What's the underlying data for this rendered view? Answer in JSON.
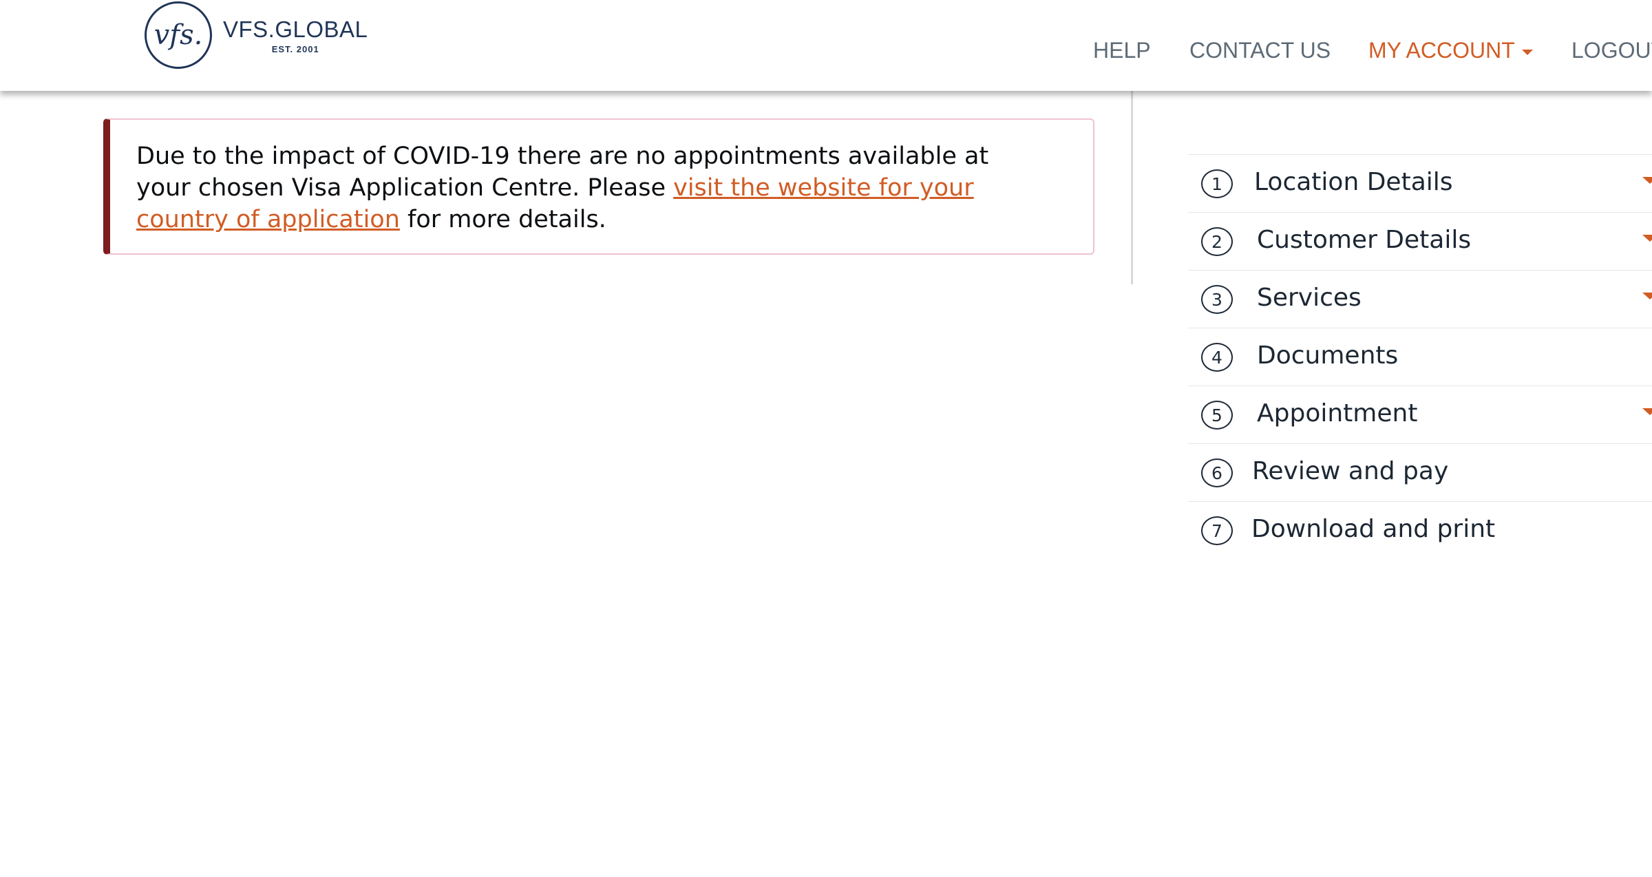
{
  "header": {
    "logo_mark": "vfs.",
    "logo_name": "VFS.GLOBAL",
    "logo_est": "EST. 2001",
    "nav": {
      "help": "HELP",
      "contact": "CONTACT US",
      "account": "MY ACCOUNT",
      "logout": "LOGOUT"
    }
  },
  "alert": {
    "text_before": "Due to the impact of COVID-19 there are no appointments available at your chosen Visa Application Centre. Please ",
    "link_text": "visit the website for your country of application",
    "text_after": " for more details."
  },
  "steps": [
    {
      "number": "1",
      "label": "Location Details",
      "has_dropdown": true
    },
    {
      "number": "2",
      "label": "Customer Details",
      "has_dropdown": true
    },
    {
      "number": "3",
      "label": "Services",
      "has_dropdown": true
    },
    {
      "number": "4",
      "label": "Documents",
      "has_dropdown": false
    },
    {
      "number": "5",
      "label": "Appointment",
      "has_dropdown": true
    },
    {
      "number": "6",
      "label": "Review and pay",
      "has_dropdown": false
    },
    {
      "number": "7",
      "label": "Download and print",
      "has_dropdown": false
    }
  ],
  "colors": {
    "brand_navy": "#1f3557",
    "accent_orange": "#d15c24",
    "alert_border": "#7c1e1f"
  }
}
